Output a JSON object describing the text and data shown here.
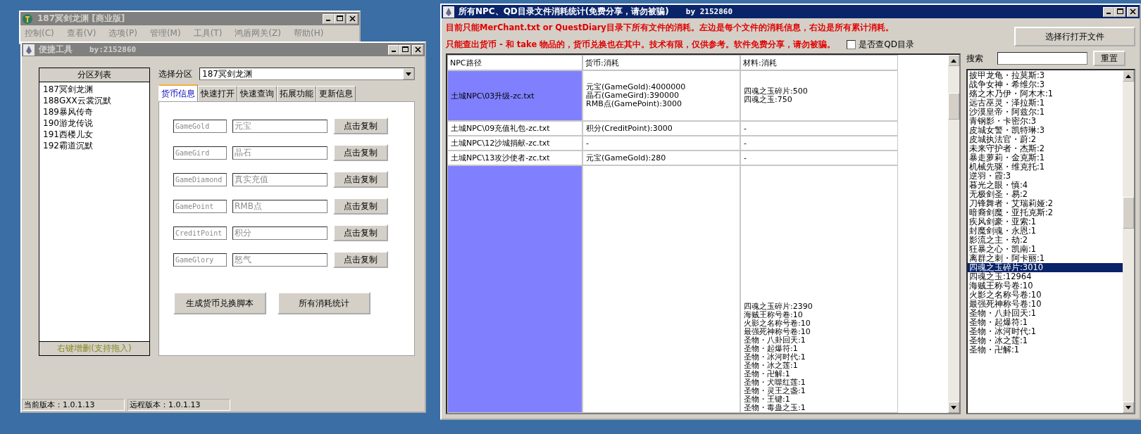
{
  "main_window": {
    "title": "187冥剑龙渊 [商业版]",
    "menu": [
      "控制(C)",
      "查看(V)",
      "选项(P)",
      "管理(M)",
      "工具(T)",
      "鸿盾网关(Z)",
      "帮助(H)"
    ]
  },
  "tool_window": {
    "title": "便捷工具",
    "author": "by:2152860",
    "server_list": {
      "header": "分区列表",
      "items": [
        "187冥剑龙渊",
        "188GXX云裳沉默",
        "189暴风传奇",
        "190游龙传说",
        "191西楼儿女",
        "192霸道沉默"
      ],
      "footer": "右键增删(支持拖入)"
    },
    "server_select": {
      "label": "选择分区",
      "value": "187冥剑龙渊"
    },
    "tabs": [
      {
        "label": "货币信息",
        "selected": true
      },
      {
        "label": "快速打开",
        "selected": false
      },
      {
        "label": "快速查询",
        "selected": false
      },
      {
        "label": "拓展功能",
        "selected": false
      },
      {
        "label": "更新信息",
        "selected": false
      }
    ],
    "currency_rows": [
      {
        "code": {
          "placeholder": "GameGold"
        },
        "name": {
          "placeholder": "元宝"
        },
        "button": "点击复制"
      },
      {
        "code": {
          "placeholder": "GameGird"
        },
        "name": {
          "placeholder": "晶石"
        },
        "button": "点击复制"
      },
      {
        "code": {
          "placeholder": "GameDiamond"
        },
        "name": {
          "placeholder": "真实充值"
        },
        "button": "点击复制"
      },
      {
        "code": {
          "placeholder": "GamePoint"
        },
        "name": {
          "placeholder": "RMB点"
        },
        "button": "点击复制"
      },
      {
        "code": {
          "placeholder": "CreditPoint"
        },
        "name": {
          "placeholder": "积分"
        },
        "button": "点击复制"
      },
      {
        "code": {
          "placeholder": "GameGlory"
        },
        "name": {
          "placeholder": "怒气"
        },
        "button": "点击复制"
      }
    ],
    "actions": [
      "生成货币兑换脚本",
      "所有消耗统计"
    ],
    "status_bar": [
      "当前版本：1.0.1.13",
      "远程版本：1.0.1.13"
    ]
  },
  "stats_window": {
    "title": "所有NPC、QD目录文件消耗统计(免费分享，请勿被骗)",
    "author": "by 2152860",
    "notices": [
      "目前只能MerChant.txt or QuestDiary目录下所有文件的消耗。左边是每个文件的消耗信息，右边是所有累计消耗。",
      "只能查出货币 - 和 take 物品的，货币兑换也在其中。技术有限，仅供参考。软件免费分享，请勿被骗。"
    ],
    "qd_checkbox": {
      "label": "是否查QD目录",
      "checked": false
    },
    "open_button": "选择行打开文件",
    "search": {
      "label": "搜索",
      "reset": "重置"
    },
    "table": {
      "columns": [
        "NPC路径",
        "货币:消耗",
        "材料:消耗"
      ],
      "rows": [
        {
          "path": "土城NPC\\03升级-zc.txt",
          "currency": [
            "元宝(GameGold):4000000",
            "晶石(GameGird):390000",
            "RMB点(GamePoint):3000"
          ],
          "materials": [
            "四魂之玉碎片:500",
            "四魂之玉:750"
          ],
          "selected": true
        },
        {
          "path": "土城NPC\\09充值礼包-zc.txt",
          "currency": [
            "积分(CreditPoint):3000"
          ],
          "materials": [
            "-"
          ],
          "selected": false
        },
        {
          "path": "土城NPC\\12沙城捐献-zc.txt",
          "currency": [
            "-"
          ],
          "materials": [
            "-"
          ],
          "selected": false
        },
        {
          "path": "土城NPC\\13攻沙使者-zc.txt",
          "currency": [
            "元宝(GameGold):280"
          ],
          "materials": [
            "-"
          ],
          "selected": false
        },
        {
          "materials": [
            "四魂之玉碎片:2390",
            "海贼王称号卷:10",
            "火影之名称号卷:10",
            "最强死神称号卷:10",
            "圣物・八卦回天:1",
            "圣物・起爆符:1",
            "圣物・冰河时代:1",
            "圣物・冰之莲:1",
            "圣物・卍解:1",
            "圣物・犬噬红莲:1",
            "圣物・灵王之盏:1",
            "圣物・王键:1",
            "圣物・毒蛊之玉:1"
          ],
          "selected": true
        }
      ]
    },
    "totals": [
      {
        "label": "披甲龙龟・拉莫斯:3",
        "selected": false
      },
      {
        "label": "战争女神・希维尔:3",
        "selected": false
      },
      {
        "label": "殇之木乃伊・阿木木:1",
        "selected": false
      },
      {
        "label": "远古巫灵・泽拉斯:1",
        "selected": false
      },
      {
        "label": "沙漠皇帝・阿兹尔:1",
        "selected": false
      },
      {
        "label": "青钢影・卡密尔:3",
        "selected": false
      },
      {
        "label": "皮城女警・凯特琳:3",
        "selected": false
      },
      {
        "label": "皮城执法官・蔚:2",
        "selected": false
      },
      {
        "label": "未来守护者・杰斯:2",
        "selected": false
      },
      {
        "label": "暴走萝莉・金克斯:1",
        "selected": false
      },
      {
        "label": "机械先驱・维克托:1",
        "selected": false
      },
      {
        "label": "逆羽・霞:3",
        "selected": false
      },
      {
        "label": "暮光之眼・慎:4",
        "selected": false
      },
      {
        "label": "无极剑圣・易:2",
        "selected": false
      },
      {
        "label": "刀锋舞者・艾瑞莉娅:2",
        "selected": false
      },
      {
        "label": "暗裔剑魔・亚托克斯:2",
        "selected": false
      },
      {
        "label": "疾风剑豪・亚索:1",
        "selected": false
      },
      {
        "label": "封魔剑魂・永恩:1",
        "selected": false
      },
      {
        "label": "影流之主・劫:2",
        "selected": false
      },
      {
        "label": "狂暴之心・凯南:1",
        "selected": false
      },
      {
        "label": "离群之刺・阿卡丽:1",
        "selected": false
      },
      {
        "label": "四魂之玉碎片:3010",
        "selected": true
      },
      {
        "label": "四魂之玉:12964",
        "selected": false
      },
      {
        "label": "海贼王称号卷:10",
        "selected": false
      },
      {
        "label": "火影之名称号卷:10",
        "selected": false
      },
      {
        "label": "最强死神称号卷:10",
        "selected": false
      },
      {
        "label": "圣物・八卦回天:1",
        "selected": false
      },
      {
        "label": "圣物・起爆符:1",
        "selected": false
      },
      {
        "label": "圣物・冰河时代:1",
        "selected": false
      },
      {
        "label": "圣物・冰之莲:1",
        "selected": false
      },
      {
        "label": "圣物・卍解:1",
        "selected": false
      }
    ]
  }
}
